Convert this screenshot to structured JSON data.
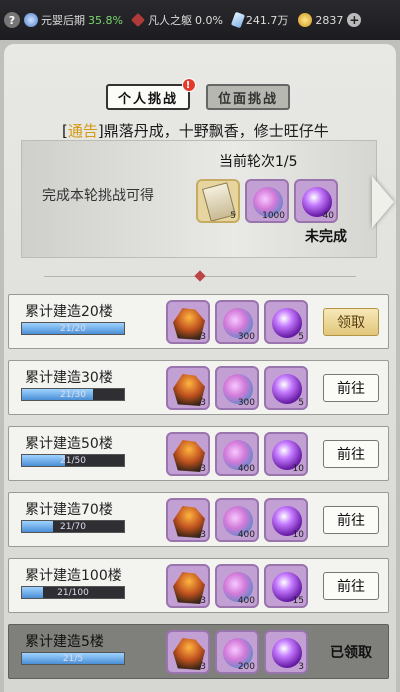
{
  "topbar": {
    "help": "?",
    "realm_label": "元婴后期",
    "realm_pct": "35.8%",
    "mortal_label": "凡人之躯",
    "mortal_pct": "0.0%",
    "spirit_stones": "241.7万",
    "gold": "2837",
    "plus": "+"
  },
  "tabs": [
    {
      "label": "个人挑战",
      "active": true,
      "badge": "!"
    },
    {
      "label": "位面挑战",
      "active": false
    }
  ],
  "notice": {
    "tag": "通告",
    "text": "鼎落丹成，十野飘香，修士旺仔牛"
  },
  "banner": {
    "label": "完成本轮挑战可得",
    "round": "当前轮次1/5",
    "status": "未完成",
    "rewards": [
      {
        "icon": "scroll-icon",
        "count": "5"
      },
      {
        "icon": "blue-orb-icon",
        "count": "1000"
      },
      {
        "icon": "purple-orb-icon",
        "count": "40"
      }
    ]
  },
  "tasks": [
    {
      "title": "累计建造20楼",
      "progress_text": "21/20",
      "progress": 1.0,
      "rewards": [
        "3",
        "300",
        "5"
      ],
      "action": "领取",
      "state": "claim"
    },
    {
      "title": "累计建造30楼",
      "progress_text": "21/30",
      "progress": 0.7,
      "rewards": [
        "3",
        "300",
        "5"
      ],
      "action": "前往",
      "state": "go"
    },
    {
      "title": "累计建造50楼",
      "progress_text": "21/50",
      "progress": 0.42,
      "rewards": [
        "3",
        "400",
        "10"
      ],
      "action": "前往",
      "state": "go"
    },
    {
      "title": "累计建造70楼",
      "progress_text": "21/70",
      "progress": 0.3,
      "rewards": [
        "3",
        "400",
        "10"
      ],
      "action": "前往",
      "state": "go"
    },
    {
      "title": "累计建造100楼",
      "progress_text": "21/100",
      "progress": 0.21,
      "rewards": [
        "3",
        "400",
        "15"
      ],
      "action": "前往",
      "state": "go"
    },
    {
      "title": "累计建造5楼",
      "progress_text": "21/5",
      "progress": 1.0,
      "rewards": [
        "3",
        "200",
        "3"
      ],
      "action": "已领取",
      "state": "claimed"
    }
  ]
}
